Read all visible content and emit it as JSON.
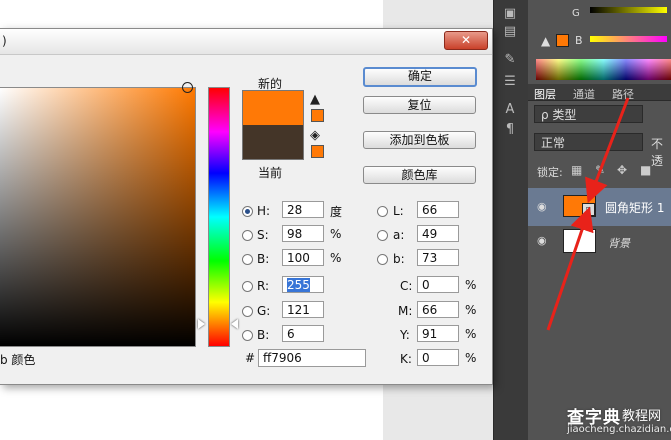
{
  "dialog": {
    "title_fragment": ")",
    "close_glyph": "✕",
    "new_label": "新的",
    "current_label": "当前",
    "new_color": "#ff7906",
    "current_color": "#443528",
    "buttons": {
      "ok": "确定",
      "reset": "复位",
      "add_to_swatches": "添加到色板",
      "color_libraries": "颜色库"
    },
    "hsb": {
      "h_label": "H:",
      "h_value": "28",
      "h_unit": "度",
      "s_label": "S:",
      "s_value": "98",
      "s_unit": "%",
      "b_label": "B:",
      "b_value": "100",
      "b_unit": "%"
    },
    "lab": {
      "l_label": "L:",
      "l_value": "66",
      "a_label": "a:",
      "a_value": "49",
      "b_label": "b:",
      "b_value": "73"
    },
    "rgb": {
      "r_label": "R:",
      "r_value": "255",
      "g_label": "G:",
      "g_value": "121",
      "b_label": "B:",
      "b_value": "6"
    },
    "cmyk": {
      "c_label": "C:",
      "c_value": "0",
      "c_unit": "%",
      "m_label": "M:",
      "m_value": "66",
      "m_unit": "%",
      "y_label": "Y:",
      "y_value": "91",
      "y_unit": "%",
      "k_label": "K:",
      "k_value": "0",
      "k_unit": "%"
    },
    "only_web_colors_fragment": "b 颜色",
    "hex_label": "#",
    "hex_value": "ff7906",
    "selected_mode": "H"
  },
  "color_panel": {
    "g_label": "G",
    "b_label": "B"
  },
  "layers_panel": {
    "tabs": [
      "图层",
      "通道",
      "路径"
    ],
    "filter_value": "ρ 类型",
    "blend_mode": "正常",
    "opacity_label": "不透",
    "lock_label": "锁定:",
    "layers": [
      {
        "name": "圆角矩形 1",
        "thumb_color": "#ff7906",
        "selected": true
      },
      {
        "name": "背景",
        "thumb_color": "#ffffff",
        "selected": false
      }
    ]
  },
  "watermark": {
    "brand": "查字典",
    "section": "教程网",
    "url": "jiaocheng.chazidian.com"
  },
  "colors": {
    "accent": "#ff7906",
    "arrow": "#e8221a",
    "selection": "#3875d7"
  }
}
